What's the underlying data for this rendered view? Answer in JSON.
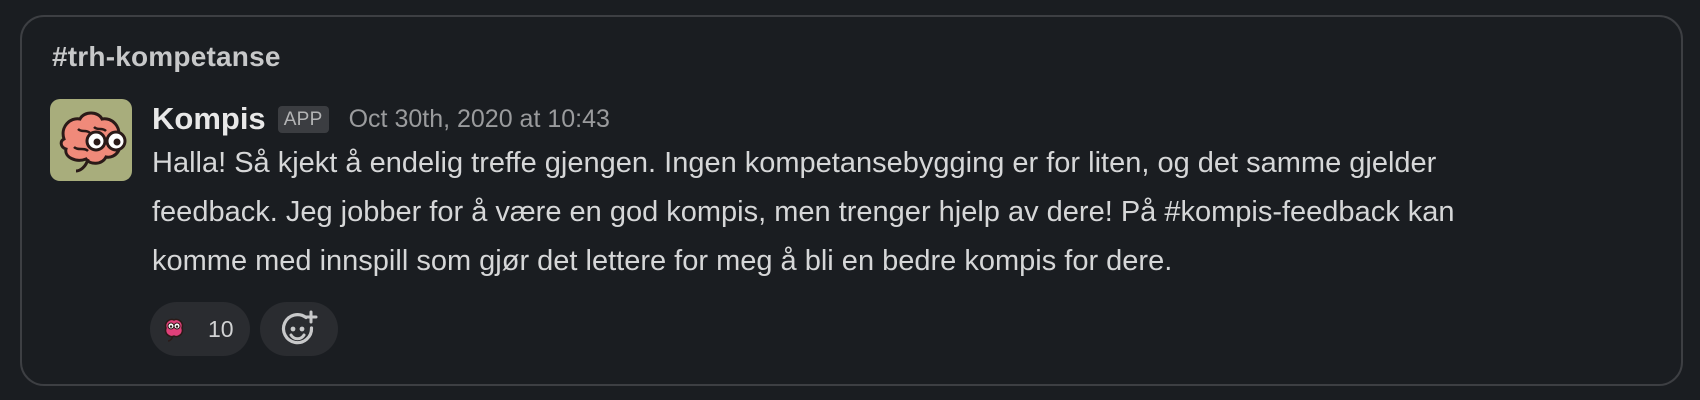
{
  "channel": {
    "name": "#trh-kompetanse"
  },
  "message": {
    "author": "Kompis",
    "badge": "APP",
    "timestamp": "Oct 30th, 2020 at 10:43",
    "avatar_icon": "brain-with-glasses-icon",
    "lines": [
      "Halla! Så kjekt å endelig treffe gjengen. Ingen kompetansebygging er for liten, og det samme gjelder",
      "feedback. Jeg jobber for å være en god kompis, men trenger hjelp av dere!  På #kompis-feedback kan",
      "komme med innspill som gjør det lettere for meg å bli en bedre kompis for dere."
    ]
  },
  "reactions": [
    {
      "emoji_icon": "kompis-brain-emoji-icon",
      "count": "10"
    }
  ],
  "add_reaction": {
    "icon": "add-reaction-icon"
  },
  "colors": {
    "background": "#1a1d21",
    "border": "#3d3f43",
    "avatar_bg": "#a8ad7c",
    "brain": "#f08a7a",
    "pill": "#2a2c30"
  }
}
